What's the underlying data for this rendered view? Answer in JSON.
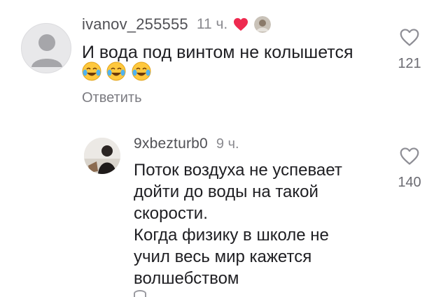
{
  "comments": [
    {
      "username": "ivanov_255555",
      "time": "11 ч.",
      "text": "И вода под винтом не колышется",
      "emoji_count": 3,
      "reply_label": "Ответить",
      "likes": "121",
      "liked_by_author": true
    },
    {
      "username": "9xbezturb0",
      "time": "9 ч.",
      "text_lines": [
        "Поток воздуха не успевает",
        "дойти до воды на такой",
        "скорости.",
        "Когда физику в школе не",
        "учил весь мир кажется",
        "волшебством"
      ],
      "likes": "140"
    }
  ],
  "colors": {
    "heart_red": "#ee2a4f",
    "text": "#1e1e22",
    "muted": "#8a8a8f"
  },
  "icons": {
    "like": "heart-outline-icon",
    "author_like": "heart-filled-icon",
    "emoji": "face-with-tears-of-joy-icon"
  }
}
